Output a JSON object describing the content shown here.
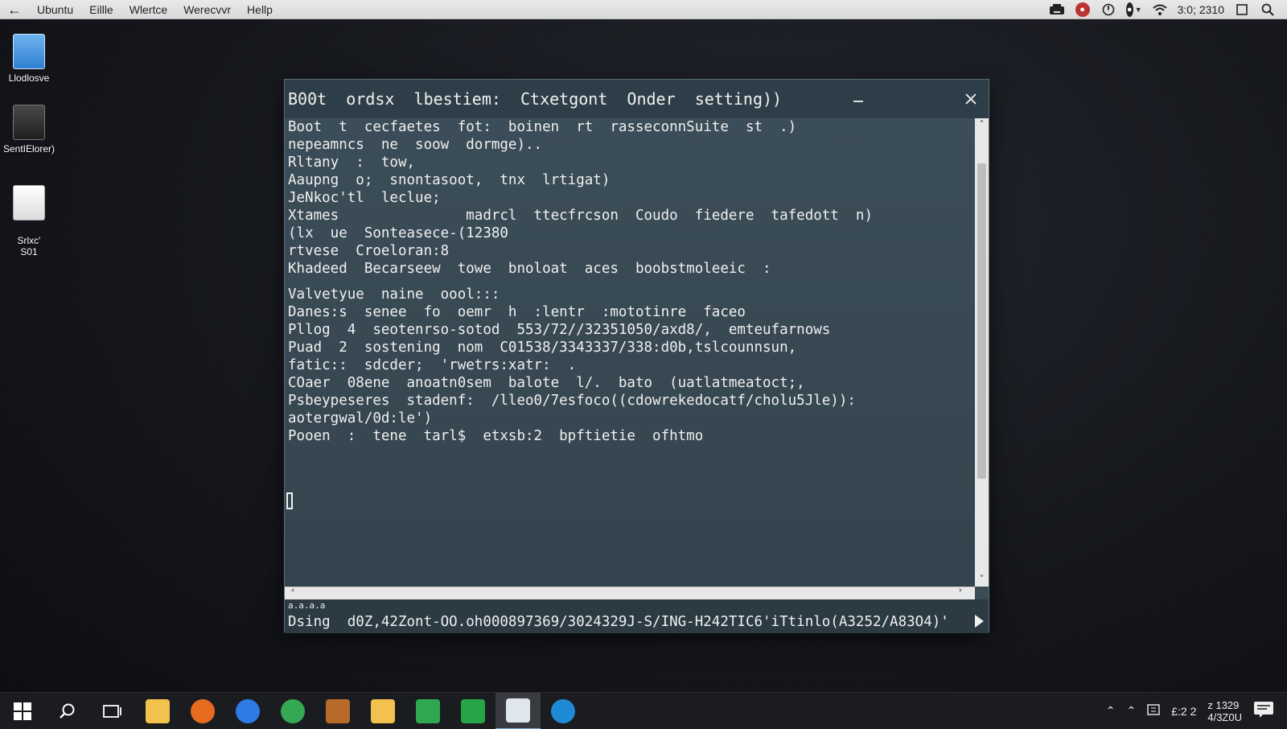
{
  "menubar": {
    "back_icon": "arrow-left-icon",
    "items": [
      "Ubuntu",
      "Eillle",
      "Wlertce",
      "Werecvvr",
      "Hellp"
    ],
    "clock": "3:0; 2310"
  },
  "desktop": {
    "icons": [
      {
        "label": "Llodlosve",
        "icon": "folder-icon"
      },
      {
        "label": "SentIElorer)",
        "icon": "terminal-app-icon"
      },
      {
        "label": "Srlxc'\nS01",
        "icon": "document-icon"
      }
    ]
  },
  "window": {
    "title": "B00t  ordsx  lbestiem:  Ctxetgont  Onder  setting))",
    "lines": [
      "Boot  t  cecfaetes  fot:  boinen  rt  rasseconnSuite  st  .)",
      "nepeamncs  ne  soow  dormge)..",
      "Rltany  :  tow,",
      "Aaupng  o;  snontasoot,  tnx  lrtigat)",
      "JeNkoc'tl  leclue;",
      "Xtames               madrcl  ttecfrcson  Coudo  fiedere  tafedott  n)",
      "(lx  ue  Sonteasece-(12380",
      "rtvese  Croeloran:8",
      "Khadeed  Becarseew  towe  bnoloat  aces  boobstmoleeic  :",
      "",
      "Valvetyue  naine  oool:::",
      "Danes:s  senee  fo  oemr  h  :lentr  :mototinre  faceo",
      "Pllog  4  seotenrso-sotod  553/72//32351050/axd8/,  emteufarnows",
      "Puad  2  sostening  nom  C01538/3343337/338:d0b,tslcounnsun,",
      "fatic::  sdcder;  'rwetrs:xatr:  .",
      "COaer  08ene  anoatn0sem  balote  l/.  bato  (uatlatmeatoct;,",
      "Psbeypeseres  stadenf:  /lleo0/7esfoco((cdowrekedocatf/cholu5Jle)):",
      "aotergwal/0d:le')",
      "Pooen  :  tene  tarl$  etxsb:2  bpftietie  ofhtmo"
    ],
    "status_small": "a.a.a.a",
    "status_command": "Dsing  d0Z,42Zont-OO.oh000897369/3024329J-S/ING-H242TIC6'iTtinlo(A3252/A83O4)'"
  },
  "taskbar": {
    "apps": [
      {
        "name": "windows-start-icon",
        "color": "#ffffff"
      },
      {
        "name": "search-icon",
        "color": "#ffffff"
      },
      {
        "name": "task-view-icon",
        "color": "#ffffff"
      },
      {
        "name": "file-explorer-icon",
        "color": "#f2c14e"
      },
      {
        "name": "firefox-icon",
        "color": "#e66b1f"
      },
      {
        "name": "facebook-icon",
        "color": "#2f7be5"
      },
      {
        "name": "chrome-icon",
        "color": "#34a853"
      },
      {
        "name": "package-icon",
        "color": "#b76a2a"
      },
      {
        "name": "folder-icon",
        "color": "#f2c14e"
      },
      {
        "name": "mail-icon",
        "color": "#2fa84f"
      },
      {
        "name": "chat-icon",
        "color": "#25a548"
      },
      {
        "name": "notepad-icon",
        "color": "#dfe6ee"
      },
      {
        "name": "skype-icon",
        "color": "#1e8ad6"
      }
    ],
    "tray_time_a": "£:2 2",
    "tray_time_b_top": "z 1329",
    "tray_time_b_bottom": "4/3Z0U"
  }
}
